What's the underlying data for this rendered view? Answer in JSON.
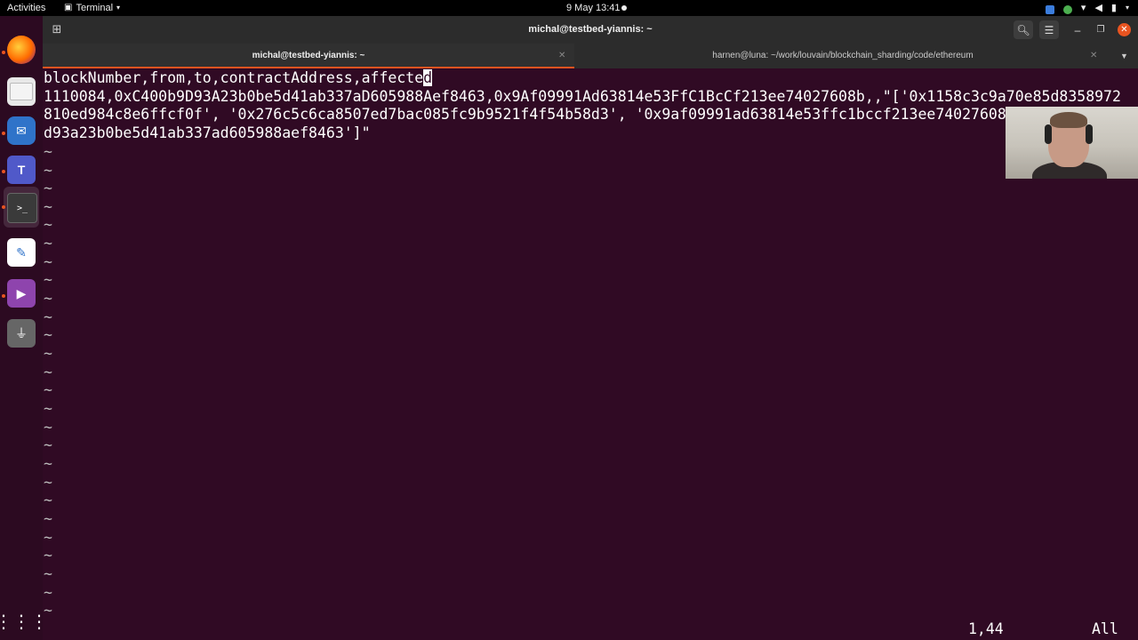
{
  "topbar": {
    "activities": "Activities",
    "app_name": "Terminal",
    "clock": "9 May  13:41"
  },
  "titlebar": {
    "title": "michal@testbed-yiannis: ~"
  },
  "tabs": [
    {
      "label": "michal@testbed-yiannis: ~",
      "active": true
    },
    {
      "label": "harnen@luna: ~/work/louvain/blockchain_sharding/code/ethereum",
      "active": false
    }
  ],
  "terminal": {
    "line1_before_cursor": "blockNumber,from,to,contractAddress,affecte",
    "line1_cursor_char": "d",
    "line2": "1110084,0xC400b9D93A23b0be5d41ab337aD605988Aef8463,0x9Af09991Ad63814e53FfC1BcCf213ee74027608b,,\"['0x1158c3c9a70e85d8358972",
    "line3": "810ed984c8e6ffcf0f', '0x276c5c6ca8507ed7bac085fc9b9521f4f54b58d3', '0x9af09991ad63814e53ffc1bccf213ee74027608",
    "line4": "d93a23b0be5d41ab337ad605988aef8463']\"",
    "tilde": "~",
    "status_position": "1,44",
    "status_scroll": "All"
  },
  "icons": {
    "activities_grid": "show-applications-icon",
    "firefox": "firefox-icon",
    "files": "files-icon",
    "mail": "mail-icon",
    "teams": "teams-icon",
    "terminal": "terminal-icon",
    "editor": "text-editor-icon",
    "video": "video-player-icon",
    "usb": "usb-drive-icon"
  },
  "colors": {
    "terminal_bg": "#300a24",
    "accent": "#e95420"
  }
}
